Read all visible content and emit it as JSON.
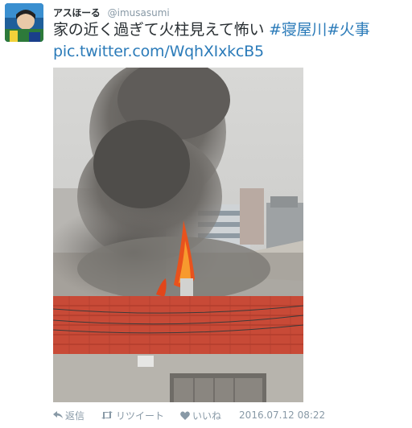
{
  "tweet": {
    "display_name": "アスほーる",
    "handle": "@imusasumi",
    "text_main": "家の近く過ぎて火柱見えて怖い ",
    "hashtags": "#寝屋川#火事",
    "link": "pic.twitter.com/WqhXIxkcB5",
    "timestamp": "2016.07.12 08:22"
  },
  "actions": {
    "reply_label": "返信",
    "retweet_label": "リツイート",
    "like_label": "いいね"
  },
  "icons": {
    "reply": "reply-icon",
    "retweet": "retweet-icon",
    "like": "heart-icon"
  },
  "colors": {
    "link": "#2b7bb9",
    "meta": "#8899a6",
    "text": "#292f33"
  }
}
